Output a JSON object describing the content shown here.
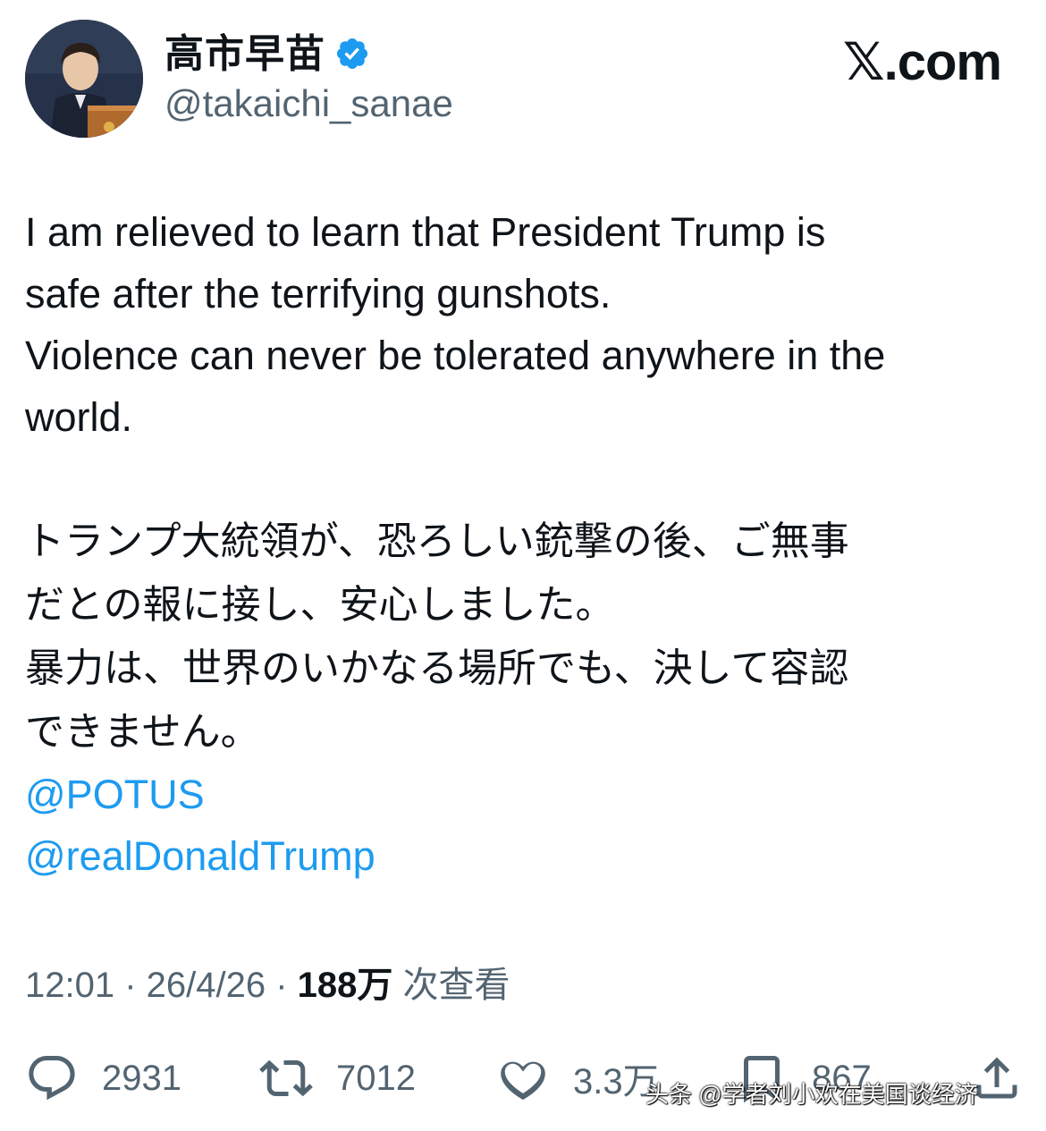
{
  "header": {
    "display_name": "高市早苗",
    "handle": "@takaichi_sanae",
    "site": "𝕏.com",
    "verified_color": "#1d9bf0"
  },
  "tweet": {
    "en_line1": "I am relieved to learn that President Trump is",
    "en_line2": "safe after the terrifying gunshots.",
    "en_line3": "Violence can never be tolerated anywhere in the",
    "en_line4": "world.",
    "jp_line1": "トランプ大統領が、恐ろしい銃撃の後、ご無事",
    "jp_line2": "だとの報に接し、安心しました。",
    "jp_line3": "暴力は、世界のいかなる場所でも、決して容認",
    "jp_line4": "できません。",
    "mentions": [
      "@POTUS",
      "@realDonaldTrump"
    ]
  },
  "meta": {
    "time": "12:01",
    "sep1": " · ",
    "date": "26/4/26",
    "sep2": " · ",
    "views": "188万",
    "views_label": " 次查看"
  },
  "actions": {
    "reply_count": "2931",
    "retweet_count": "7012",
    "like_count": "3.3万",
    "bookmark_count": "867"
  },
  "watermark": "头条 @学者刘小欢在美国谈经济",
  "colors": {
    "text": "#0f1419",
    "secondary": "#536471",
    "link": "#1d9bf0"
  }
}
